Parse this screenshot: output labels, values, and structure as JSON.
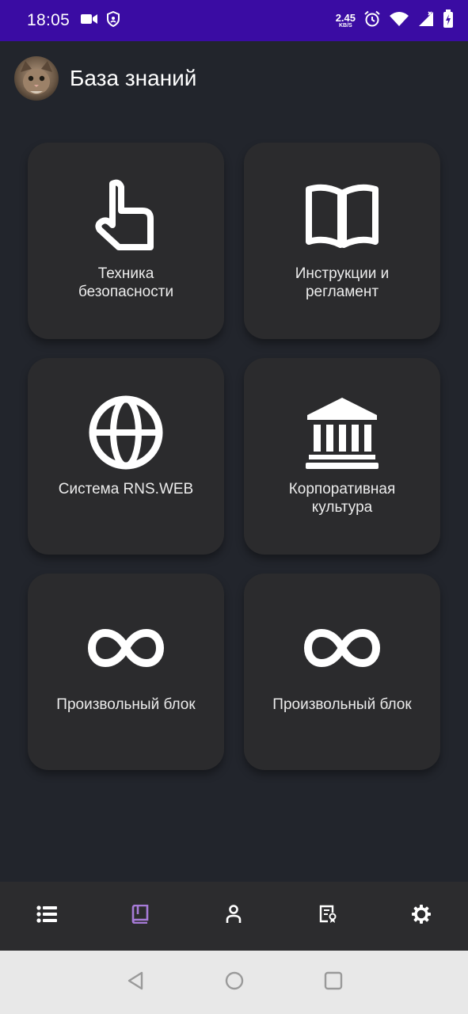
{
  "status_bar": {
    "time": "18:05",
    "net_speed_value": "2.45",
    "net_speed_unit": "KB/S",
    "icons": [
      "video-camera-icon",
      "shield-icon",
      "alarm-icon",
      "wifi-icon",
      "signal-icon",
      "battery-icon"
    ]
  },
  "header": {
    "title": "База знаний",
    "avatar": "cat-avatar"
  },
  "tiles": [
    {
      "label": "Техника\nбезопасности",
      "icon": "pointing-hand-icon"
    },
    {
      "label": "Инструкции и\nрегламент",
      "icon": "open-book-icon"
    },
    {
      "label": "Система RNS.WEB",
      "icon": "globe-icon"
    },
    {
      "label": "Корпоративная\nкультура",
      "icon": "bank-building-icon"
    },
    {
      "label": "Произвольный блок",
      "icon": "infinity-icon"
    },
    {
      "label": "Произвольный блок",
      "icon": "infinity-icon"
    }
  ],
  "bottom_nav": {
    "items": [
      "list-icon",
      "book-icon",
      "user-icon",
      "certificate-icon",
      "gear-icon"
    ],
    "active_index": 1,
    "active_color": "#a77bd8",
    "inactive_color": "#ffffff"
  },
  "colors": {
    "status_bar": "#3a0ca3",
    "background": "#22252c",
    "tile": "#2b2b2d"
  }
}
